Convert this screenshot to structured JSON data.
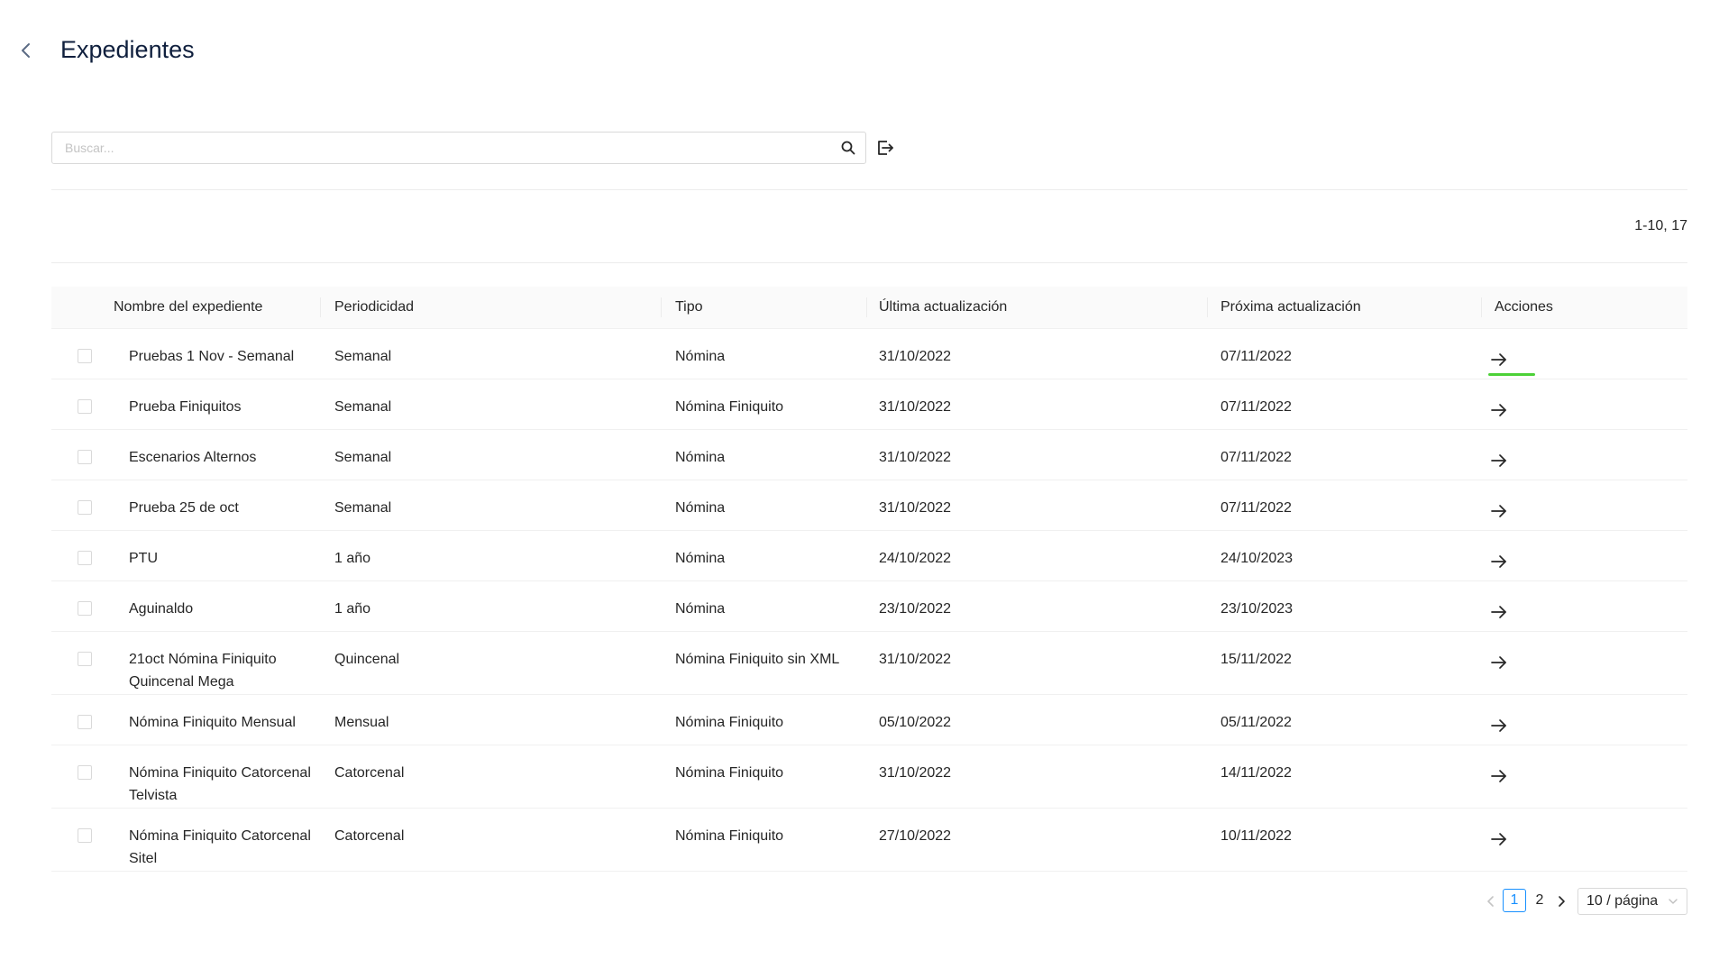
{
  "header": {
    "title": "Expedientes"
  },
  "search": {
    "placeholder": "Buscar..."
  },
  "range_text": "1-10, 17",
  "table": {
    "columns": [
      "Nombre del expediente",
      "Periodicidad",
      "Tipo",
      "Última actualización",
      "Próxima actualización",
      "Acciones"
    ],
    "rows": [
      {
        "nombre": [
          "Pruebas 1 Nov - Semanal"
        ],
        "periodicidad": "Semanal",
        "tipo": "Nómina",
        "ultima": "31/10/2022",
        "proxima": "07/11/2022"
      },
      {
        "nombre": [
          "Prueba Finiquitos"
        ],
        "periodicidad": "Semanal",
        "tipo": "Nómina Finiquito",
        "ultima": "31/10/2022",
        "proxima": "07/11/2022"
      },
      {
        "nombre": [
          "Escenarios Alternos"
        ],
        "periodicidad": "Semanal",
        "tipo": "Nómina",
        "ultima": "31/10/2022",
        "proxima": "07/11/2022"
      },
      {
        "nombre": [
          "Prueba 25 de oct"
        ],
        "periodicidad": "Semanal",
        "tipo": "Nómina",
        "ultima": "31/10/2022",
        "proxima": "07/11/2022"
      },
      {
        "nombre": [
          "PTU"
        ],
        "periodicidad": "1 año",
        "tipo": "Nómina",
        "ultima": "24/10/2022",
        "proxima": "24/10/2023"
      },
      {
        "nombre": [
          "Aguinaldo"
        ],
        "periodicidad": "1 año",
        "tipo": "Nómina",
        "ultima": "23/10/2022",
        "proxima": "23/10/2023"
      },
      {
        "nombre": [
          "21oct Nómina Finiquito",
          "Quincenal Mega"
        ],
        "periodicidad": "Quincenal",
        "tipo": "Nómina Finiquito sin XML",
        "ultima": "31/10/2022",
        "proxima": "15/11/2022"
      },
      {
        "nombre": [
          "Nómina Finiquito Mensual"
        ],
        "periodicidad": "Mensual",
        "tipo": "Nómina Finiquito",
        "ultima": "05/10/2022",
        "proxima": "05/11/2022"
      },
      {
        "nombre": [
          "Nómina Finiquito Catorcenal",
          "Telvista"
        ],
        "periodicidad": "Catorcenal",
        "tipo": "Nómina Finiquito",
        "ultima": "31/10/2022",
        "proxima": "14/11/2022"
      },
      {
        "nombre": [
          "Nómina Finiquito Catorcenal",
          "Sitel"
        ],
        "periodicidad": "Catorcenal",
        "tipo": "Nómina Finiquito",
        "ultima": "27/10/2022",
        "proxima": "10/11/2022"
      }
    ]
  },
  "pagination": {
    "pages": [
      "1",
      "2"
    ],
    "current": "1",
    "page_size_label": "10 / página"
  },
  "colors": {
    "accent": "#1890ff",
    "highlight": "#4cd137",
    "title": "#0f1f3d"
  },
  "icons": {
    "back": "chevron-left-icon",
    "search": "search-icon",
    "export": "export-icon",
    "action": "arrow-right-icon"
  }
}
